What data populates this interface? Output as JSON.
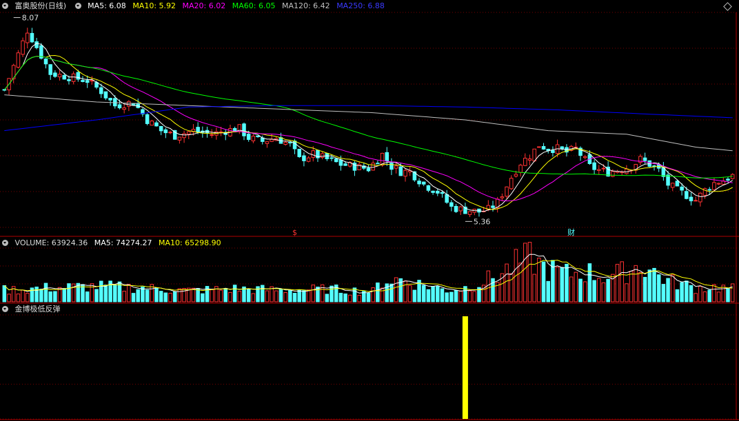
{
  "price_header": {
    "stock_title": "富奥股份(日线)",
    "ma5": "MA5: 6.08",
    "ma10": "MA10: 5.92",
    "ma20": "MA20: 6.02",
    "ma60": "MA60: 6.05",
    "ma120": "MA120: 6.42",
    "ma250": "MA250: 6.88"
  },
  "volume_header": {
    "label": "VOLUME: 63924.36",
    "ma5": "MA5: 74274.27",
    "ma10": "MA10: 65298.90"
  },
  "indicator_header": {
    "label": "金博极低反弹"
  },
  "colors": {
    "up": "#ff3232",
    "down": "#54ffff",
    "ma5": "#ffffff",
    "ma10": "#ffff00",
    "ma20": "#ff00ff",
    "ma60": "#00ff00",
    "ma120": "#c0c0c0",
    "ma250": "#0000ff",
    "grid": "#7a0000",
    "signal": "#ffff00"
  },
  "chart_data": [
    {
      "type": "candlestick",
      "series_name": "富奥股份(日线)",
      "ylim": [
        5.2,
        8.2
      ],
      "annotations": [
        {
          "label": "8.07",
          "x_index": 2,
          "value": 8.07,
          "kind": "high"
        },
        {
          "label": "5.36",
          "x_index": 100,
          "value": 5.36,
          "kind": "low"
        },
        {
          "label": "$",
          "x_index": 63,
          "kind": "event-marker",
          "color": "#ff3232"
        },
        {
          "label": "财",
          "x_index": 123,
          "kind": "event-marker",
          "color": "#54ffff"
        }
      ],
      "anchors": [
        [
          0,
          7.12
        ],
        [
          2,
          7.45
        ],
        [
          5,
          7.95
        ],
        [
          8,
          7.6
        ],
        [
          10,
          7.35
        ],
        [
          14,
          7.3
        ],
        [
          18,
          7.25
        ],
        [
          21,
          7.1
        ],
        [
          24,
          6.9
        ],
        [
          28,
          6.95
        ],
        [
          31,
          6.7
        ],
        [
          34,
          6.55
        ],
        [
          37,
          6.48
        ],
        [
          41,
          6.55
        ],
        [
          45,
          6.5
        ],
        [
          48,
          6.55
        ],
        [
          51,
          6.58
        ],
        [
          53,
          6.45
        ],
        [
          56,
          6.4
        ],
        [
          59,
          6.45
        ],
        [
          62,
          6.35
        ],
        [
          64,
          6.15
        ],
        [
          67,
          6.22
        ],
        [
          70,
          6.15
        ],
        [
          73,
          6.08
        ],
        [
          76,
          6.05
        ],
        [
          79,
          6.02
        ],
        [
          82,
          6.22
        ],
        [
          84,
          6.05
        ],
        [
          86,
          5.98
        ],
        [
          88,
          5.98
        ],
        [
          91,
          5.8
        ],
        [
          94,
          5.7
        ],
        [
          97,
          5.48
        ],
        [
          100,
          5.44
        ],
        [
          103,
          5.42
        ],
        [
          105,
          5.45
        ],
        [
          107,
          5.55
        ],
        [
          110,
          5.9
        ],
        [
          112,
          6.1
        ],
        [
          114,
          6.2
        ],
        [
          116,
          6.35
        ],
        [
          118,
          6.3
        ],
        [
          120,
          6.3
        ],
        [
          122,
          6.25
        ],
        [
          124,
          6.3
        ],
        [
          127,
          6.05
        ],
        [
          129,
          6.0
        ],
        [
          131,
          5.97
        ],
        [
          133,
          6.0
        ],
        [
          136,
          6.05
        ],
        [
          138,
          6.15
        ],
        [
          140,
          6.08
        ],
        [
          142,
          6.0
        ],
        [
          144,
          5.8
        ],
        [
          146,
          5.72
        ],
        [
          148,
          5.65
        ],
        [
          150,
          5.58
        ],
        [
          152,
          5.72
        ],
        [
          154,
          5.82
        ],
        [
          156,
          5.86
        ],
        [
          158,
          5.92
        ]
      ],
      "moving_averages": {
        "ma120": [
          [
            0,
            7.05
          ],
          [
            20,
            6.95
          ],
          [
            40,
            6.9
          ],
          [
            60,
            6.85
          ],
          [
            80,
            6.8
          ],
          [
            100,
            6.7
          ],
          [
            118,
            6.55
          ],
          [
            135,
            6.5
          ],
          [
            150,
            6.32
          ],
          [
            158,
            6.27
          ]
        ],
        "ma250": [
          [
            0,
            6.55
          ],
          [
            20,
            6.7
          ],
          [
            40,
            6.88
          ],
          [
            60,
            6.9
          ],
          [
            80,
            6.9
          ],
          [
            100,
            6.88
          ],
          [
            120,
            6.84
          ],
          [
            140,
            6.78
          ],
          [
            158,
            6.73
          ]
        ]
      }
    },
    {
      "type": "bar",
      "series_name": "VOLUME",
      "ylim": [
        0,
        110000
      ],
      "anchors": [
        [
          0,
          25000
        ],
        [
          10,
          30000
        ],
        [
          20,
          33000
        ],
        [
          30,
          30000
        ],
        [
          40,
          24000
        ],
        [
          50,
          28000
        ],
        [
          60,
          25000
        ],
        [
          70,
          27000
        ],
        [
          80,
          22000
        ],
        [
          82,
          45000
        ],
        [
          86,
          48000
        ],
        [
          90,
          38000
        ],
        [
          96,
          25000
        ],
        [
          100,
          30000
        ],
        [
          105,
          48000
        ],
        [
          108,
          62000
        ],
        [
          110,
          75000
        ],
        [
          112,
          85000
        ],
        [
          114,
          95000
        ],
        [
          116,
          80000
        ],
        [
          118,
          70000
        ],
        [
          122,
          60000
        ],
        [
          126,
          65000
        ],
        [
          130,
          55000
        ],
        [
          134,
          62000
        ],
        [
          138,
          80000
        ],
        [
          140,
          70000
        ],
        [
          144,
          45000
        ],
        [
          150,
          30000
        ],
        [
          154,
          32000
        ],
        [
          158,
          28000
        ]
      ],
      "current_value": 63924.36
    },
    {
      "type": "bar",
      "series_name": "金博极低反弹",
      "ylim": [
        0,
        1
      ],
      "signals": [
        {
          "x_index": 100,
          "value": 1
        }
      ]
    }
  ]
}
